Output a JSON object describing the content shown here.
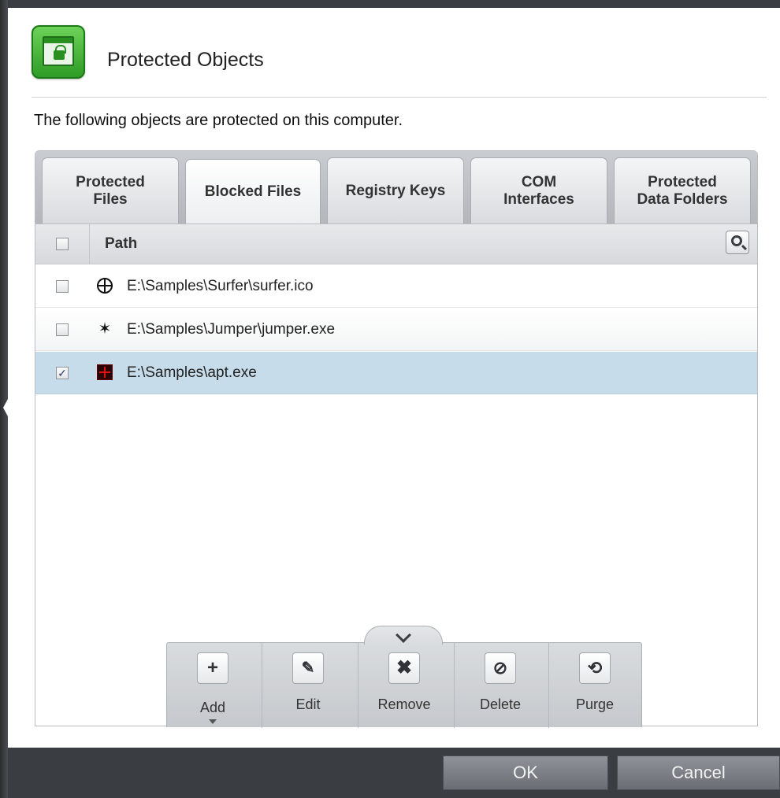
{
  "dialog": {
    "title": "Protected Objects",
    "description": "The following objects are protected on this computer."
  },
  "tabs": [
    {
      "label": "Protected\nFiles",
      "active": false
    },
    {
      "label": "Blocked Files",
      "active": true
    },
    {
      "label": "Registry Keys",
      "active": false
    },
    {
      "label": "COM\nInterfaces",
      "active": false
    },
    {
      "label": "Protected\nData Folders",
      "active": false
    }
  ],
  "table": {
    "column_header": "Path",
    "rows": [
      {
        "path": "E:\\Samples\\Surfer\\surfer.ico",
        "icon": "target-icon",
        "checked": false,
        "selected": false
      },
      {
        "path": "E:\\Samples\\Jumper\\jumper.exe",
        "icon": "spider-icon",
        "checked": false,
        "selected": false
      },
      {
        "path": "E:\\Samples\\apt.exe",
        "icon": "crosshair-app-icon",
        "checked": true,
        "selected": true
      }
    ]
  },
  "toolbar": {
    "add": "Add",
    "edit": "Edit",
    "remove": "Remove",
    "delete": "Delete",
    "purge": "Purge"
  },
  "footer": {
    "ok": "OK",
    "cancel": "Cancel"
  },
  "colors": {
    "accent_green": "#3bb02f",
    "selected_row": "#c7dcea",
    "footer_bg": "#3a3d42"
  }
}
